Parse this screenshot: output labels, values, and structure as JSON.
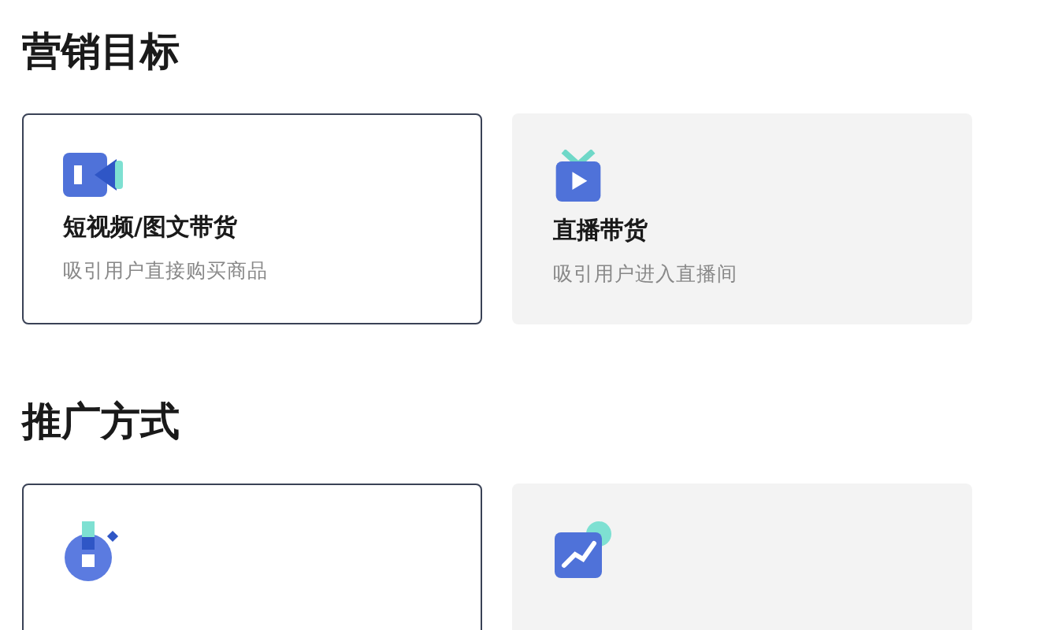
{
  "sections": [
    {
      "title": "营销目标",
      "options": [
        {
          "kind": "video",
          "title": "短视频/图文带货",
          "description": "吸引用户直接购买商品",
          "selected": true
        },
        {
          "kind": "tv",
          "title": "直播带货",
          "description": "吸引用户进入直播间",
          "selected": false
        }
      ]
    },
    {
      "title": "推广方式",
      "options": [
        {
          "kind": "stopwatch",
          "selected": true
        },
        {
          "kind": "chart",
          "selected": false
        }
      ]
    }
  ]
}
